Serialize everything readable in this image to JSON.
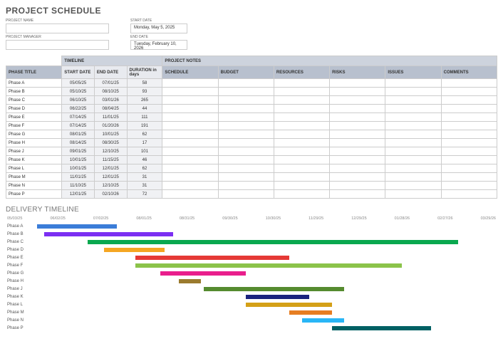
{
  "title": "PROJECT SCHEDULE",
  "labels": {
    "project_name": "PROJECT NAME",
    "project_manager": "PROJECT MANAGER",
    "start_date": "START DATE",
    "end_date": "END DATE"
  },
  "values": {
    "project_name": "",
    "project_manager": "",
    "start_date": "Monday, May 5, 2025",
    "end_date": "Tuesday, February 10, 2026"
  },
  "section_headers": {
    "timeline": "TIMELINE",
    "project_notes": "PROJECT NOTES"
  },
  "columns": {
    "phase_title": "PHASE TITLE",
    "start_date": "START DATE",
    "end_date": "END DATE",
    "duration": "DURATION in days",
    "schedule": "SCHEDULE",
    "budget": "BUDGET",
    "resources": "RESOURCES",
    "risks": "RISKS",
    "issues": "ISSUES",
    "comments": "COMMENTS"
  },
  "phases": [
    {
      "title": "Phase A",
      "start": "05/05/25",
      "end": "07/01/25",
      "duration": "58"
    },
    {
      "title": "Phase B",
      "start": "05/10/25",
      "end": "08/10/25",
      "duration": "93"
    },
    {
      "title": "Phase C",
      "start": "06/10/25",
      "end": "03/01/26",
      "duration": "265"
    },
    {
      "title": "Phase D",
      "start": "06/22/25",
      "end": "08/04/25",
      "duration": "44"
    },
    {
      "title": "Phase E",
      "start": "07/14/25",
      "end": "11/01/25",
      "duration": "111"
    },
    {
      "title": "Phase F",
      "start": "07/14/25",
      "end": "01/20/26",
      "duration": "191"
    },
    {
      "title": "Phase G",
      "start": "08/01/25",
      "end": "10/01/25",
      "duration": "62"
    },
    {
      "title": "Phase H",
      "start": "08/14/25",
      "end": "08/30/25",
      "duration": "17"
    },
    {
      "title": "Phase J",
      "start": "09/01/25",
      "end": "12/10/25",
      "duration": "101"
    },
    {
      "title": "Phase K",
      "start": "10/01/25",
      "end": "11/15/25",
      "duration": "46"
    },
    {
      "title": "Phase L",
      "start": "10/01/25",
      "end": "12/01/25",
      "duration": "62"
    },
    {
      "title": "Phase M",
      "start": "11/01/25",
      "end": "12/01/25",
      "duration": "31"
    },
    {
      "title": "Phase N",
      "start": "11/10/25",
      "end": "12/10/25",
      "duration": "31"
    },
    {
      "title": "Phase P",
      "start": "12/01/25",
      "end": "02/10/26",
      "duration": "72"
    }
  ],
  "timeline_title": "DELIVERY TIMELINE",
  "chart_data": {
    "type": "bar",
    "orientation": "horizontal-gantt",
    "x_axis_ticks": [
      "05/03/25",
      "06/02/25",
      "07/02/25",
      "08/01/25",
      "08/31/25",
      "09/30/25",
      "10/30/25",
      "11/29/25",
      "12/29/25",
      "01/28/26",
      "02/27/26",
      "03/29/26"
    ],
    "x_domain_start": "05/03/25",
    "x_domain_end": "03/29/26",
    "series": [
      {
        "name": "Phase A",
        "start": "05/05/25",
        "end": "07/01/25",
        "color": "#3b7dd8"
      },
      {
        "name": "Phase B",
        "start": "05/10/25",
        "end": "08/10/25",
        "color": "#7b2ff2"
      },
      {
        "name": "Phase C",
        "start": "06/10/25",
        "end": "03/01/26",
        "color": "#0aa84f"
      },
      {
        "name": "Phase D",
        "start": "06/22/25",
        "end": "08/04/25",
        "color": "#f5a623"
      },
      {
        "name": "Phase E",
        "start": "07/14/25",
        "end": "11/01/25",
        "color": "#e53935"
      },
      {
        "name": "Phase F",
        "start": "07/14/25",
        "end": "01/20/26",
        "color": "#8bc34a"
      },
      {
        "name": "Phase G",
        "start": "08/01/25",
        "end": "10/01/25",
        "color": "#e91e8c"
      },
      {
        "name": "Phase H",
        "start": "08/14/25",
        "end": "08/30/25",
        "color": "#9b7b2e"
      },
      {
        "name": "Phase J",
        "start": "09/01/25",
        "end": "12/10/25",
        "color": "#558b2f"
      },
      {
        "name": "Phase K",
        "start": "10/01/25",
        "end": "11/15/25",
        "color": "#1a237e"
      },
      {
        "name": "Phase L",
        "start": "10/01/25",
        "end": "12/01/25",
        "color": "#d4a017"
      },
      {
        "name": "Phase M",
        "start": "11/01/25",
        "end": "12/01/25",
        "color": "#e67e22"
      },
      {
        "name": "Phase N",
        "start": "11/10/25",
        "end": "12/10/25",
        "color": "#29b6f6"
      },
      {
        "name": "Phase P",
        "start": "12/01/25",
        "end": "02/10/26",
        "color": "#006064"
      }
    ]
  }
}
